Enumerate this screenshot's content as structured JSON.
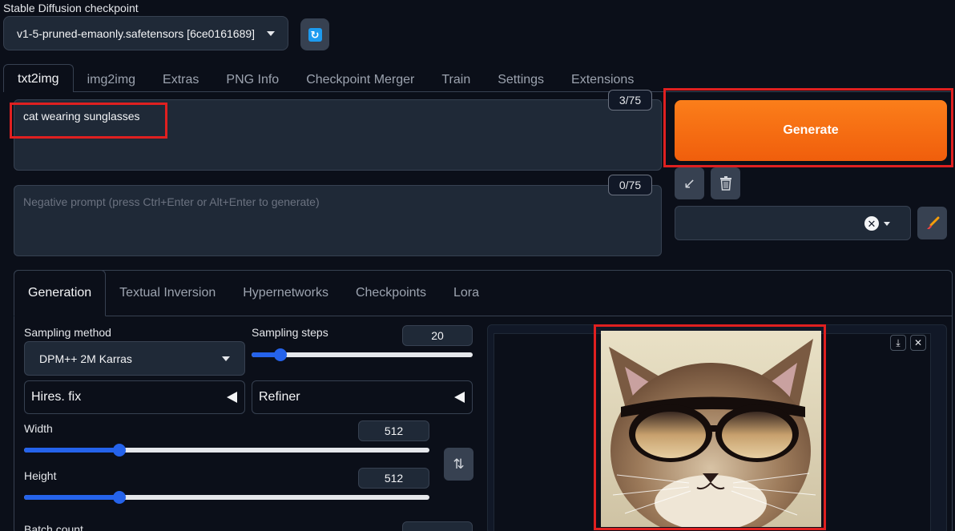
{
  "checkpoint": {
    "label": "Stable Diffusion checkpoint",
    "selected": "v1-5-pruned-emaonly.safetensors [6ce0161689]",
    "refresh_icon": "refresh-icon"
  },
  "main_tabs": [
    {
      "label": "txt2img",
      "active": true
    },
    {
      "label": "img2img"
    },
    {
      "label": "Extras"
    },
    {
      "label": "PNG Info"
    },
    {
      "label": "Checkpoint Merger"
    },
    {
      "label": "Train"
    },
    {
      "label": "Settings"
    },
    {
      "label": "Extensions"
    }
  ],
  "prompt": {
    "value": "cat wearing sunglasses",
    "token_count": "3/75"
  },
  "negative_prompt": {
    "placeholder": "Negative prompt (press Ctrl+Enter or Alt+Enter to generate)",
    "token_count": "0/75"
  },
  "generate_label": "Generate",
  "tools": {
    "read_params_icon": "arrow-icon",
    "trash_icon": "trash-icon",
    "clear_icon": "close-icon",
    "brush_icon": "brush-icon"
  },
  "sub_tabs": [
    {
      "label": "Generation",
      "active": true
    },
    {
      "label": "Textual Inversion"
    },
    {
      "label": "Hypernetworks"
    },
    {
      "label": "Checkpoints"
    },
    {
      "label": "Lora"
    }
  ],
  "sampling_method": {
    "label": "Sampling method",
    "value": "DPM++ 2M Karras"
  },
  "sampling_steps": {
    "label": "Sampling steps",
    "value": "20",
    "fraction": 0.13
  },
  "hires_fix": {
    "label": "Hires. fix"
  },
  "refiner": {
    "label": "Refiner"
  },
  "width": {
    "label": "Width",
    "value": "512",
    "fraction": 0.235
  },
  "height": {
    "label": "Height",
    "value": "512",
    "fraction": 0.235
  },
  "batch_count": {
    "label": "Batch count"
  },
  "output": {
    "image_alt": "cat wearing sunglasses",
    "download_icon": "download-icon",
    "close_icon": "close-icon"
  },
  "colors": {
    "accent": "#f97316",
    "background": "#0b0f19",
    "highlight": "#e02020",
    "slider": "#2563eb"
  }
}
